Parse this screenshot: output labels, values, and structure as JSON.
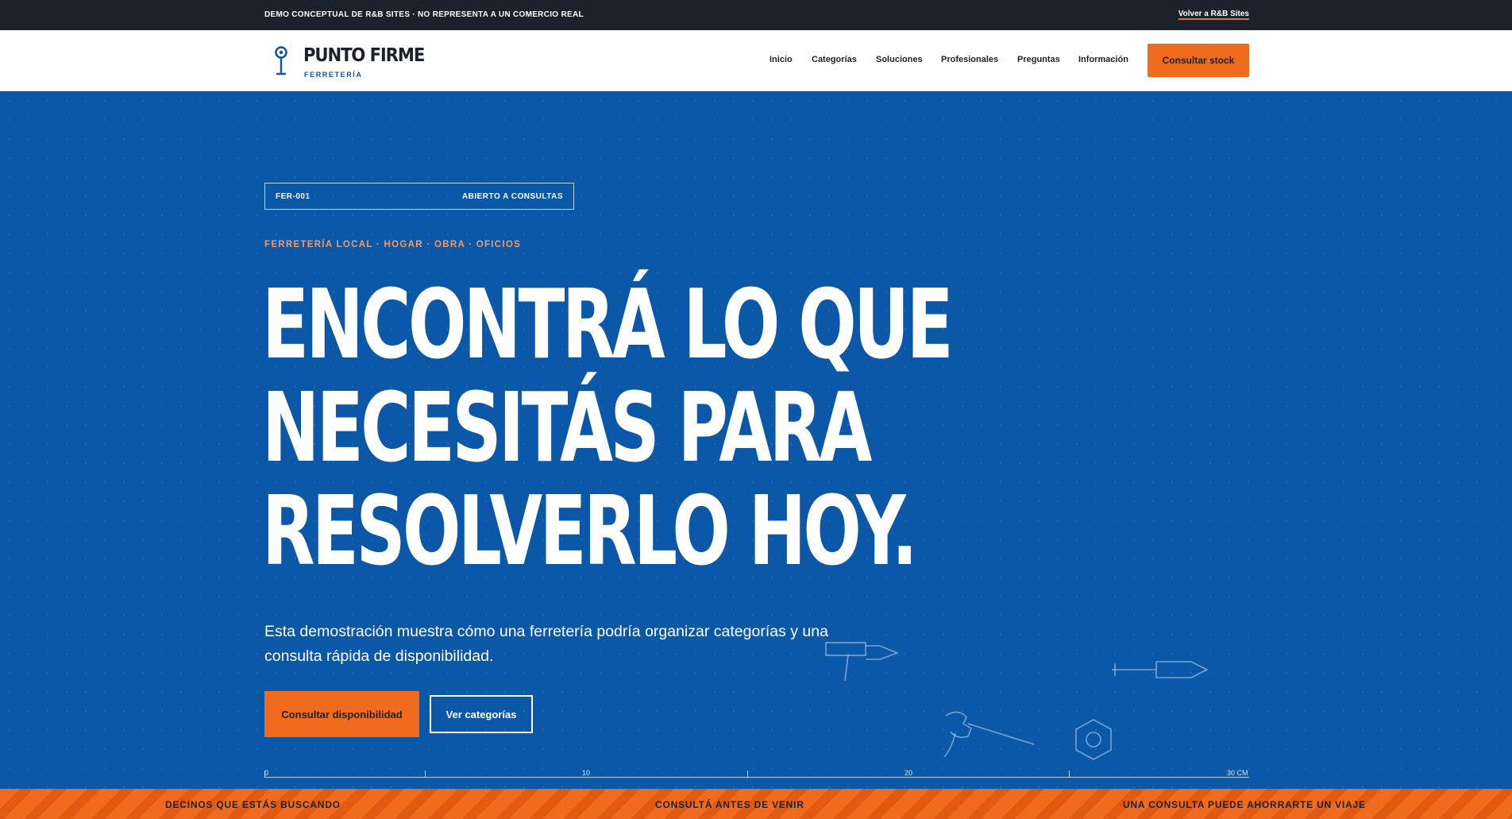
{
  "topbar": {
    "notice": "DEMO CONCEPTUAL DE R&B SITES · NO REPRESENTA A UN COMERCIO REAL",
    "back_link": "Volver a R&B Sites"
  },
  "header": {
    "logo_icon": "location-pin-tool-icon",
    "brand": "PUNTO FIRME",
    "subbrand": "FERRETERÍA",
    "nav": [
      "Inicio",
      "Categorías",
      "Soluciones",
      "Profesionales",
      "Preguntas",
      "Información"
    ],
    "cta": "Consultar stock"
  },
  "hero": {
    "code": "FER-001",
    "status": "ABIERTO A CONSULTAS",
    "eyebrow": "FERRETERÍA LOCAL · HOGAR · OBRA · OFICIOS",
    "headline": [
      "ENCONTRÁ LO QUE",
      "NECESITÁS PARA",
      "RESOLVERLO HOY."
    ],
    "lead": "Esta demostración muestra cómo una ferretería podría organizar categorías y una consulta rápida de disponibilidad.",
    "primary_button": "Consultar disponibilidad",
    "secondary_button": "Ver categorías",
    "ruler": [
      "0",
      "10",
      "20",
      "30 CM"
    ]
  },
  "stripe": [
    "DECINOS QUE ESTÁS BUSCANDO",
    "CONSULTÁ ANTES DE VENIR",
    "UNA CONSULTA PUEDE AHORRARTE UN VIAJE"
  ],
  "colors": {
    "hero_blue": "#0b57a8",
    "accent_orange": "#f06b1d",
    "dark": "#1b222b",
    "eyebrow_orange": "#f79a5f"
  }
}
